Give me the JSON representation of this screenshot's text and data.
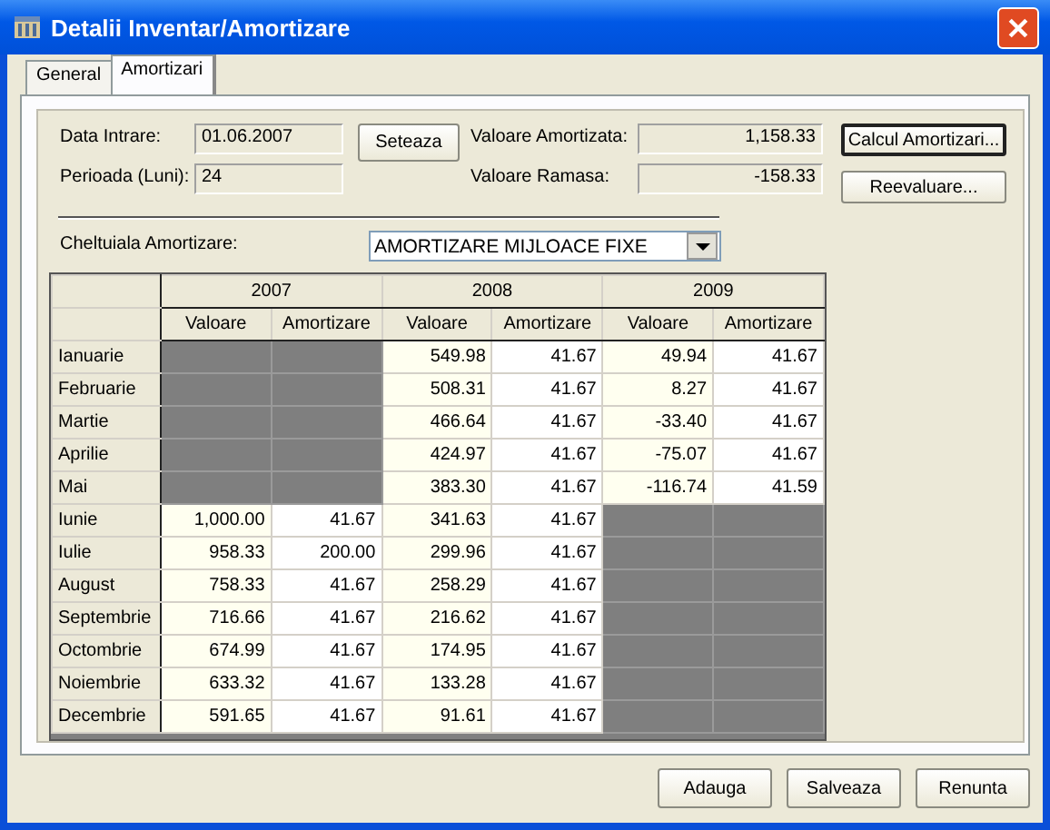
{
  "window": {
    "title": "Detalii Inventar/Amortizare"
  },
  "tabs": [
    {
      "label": "General",
      "selected": false
    },
    {
      "label": "Amortizari",
      "selected": true
    }
  ],
  "form": {
    "data_intrare": {
      "label": "Data Intrare:",
      "value": "01.06.2007"
    },
    "perioada": {
      "label": "Perioada (Luni):",
      "value": "24"
    },
    "seteaza_button": "Seteaza",
    "valoare_amortizata": {
      "label": "Valoare Amortizata:",
      "value": "1,158.33"
    },
    "valoare_ramasa": {
      "label": "Valoare Ramasa:",
      "value": "-158.33"
    },
    "cheltuiala": {
      "label": "Cheltuiala Amortizare:",
      "value": "AMORTIZARE MIJLOACE FIXE"
    }
  },
  "side_buttons": [
    {
      "label": "Calcul Amortizari...",
      "default": true
    },
    {
      "label": "Reevaluare...",
      "default": false
    }
  ],
  "table": {
    "years": [
      {
        "year": "2007",
        "columns": [
          "Valoare",
          "Amortizare"
        ]
      },
      {
        "year": "2008",
        "columns": [
          "Valoare",
          "Amortizare"
        ]
      },
      {
        "year": "2009",
        "columns": [
          "Valoare",
          "Amortizare"
        ]
      }
    ],
    "rows": [
      {
        "month": "Ianuarie",
        "cells": [
          {
            "disabled": true
          },
          {
            "disabled": true
          },
          {
            "disabled": false,
            "text": "549.98"
          },
          {
            "disabled": false,
            "text": "41.67"
          },
          {
            "disabled": false,
            "text": "49.94"
          },
          {
            "disabled": false,
            "text": "41.67"
          }
        ]
      },
      {
        "month": "Februarie",
        "cells": [
          {
            "disabled": true
          },
          {
            "disabled": true
          },
          {
            "disabled": false,
            "text": "508.31"
          },
          {
            "disabled": false,
            "text": "41.67"
          },
          {
            "disabled": false,
            "text": "8.27"
          },
          {
            "disabled": false,
            "text": "41.67"
          }
        ]
      },
      {
        "month": "Martie",
        "cells": [
          {
            "disabled": true
          },
          {
            "disabled": true
          },
          {
            "disabled": false,
            "text": "466.64"
          },
          {
            "disabled": false,
            "text": "41.67"
          },
          {
            "disabled": false,
            "text": "-33.40"
          },
          {
            "disabled": false,
            "text": "41.67"
          }
        ]
      },
      {
        "month": "Aprilie",
        "cells": [
          {
            "disabled": true
          },
          {
            "disabled": true
          },
          {
            "disabled": false,
            "text": "424.97"
          },
          {
            "disabled": false,
            "text": "41.67"
          },
          {
            "disabled": false,
            "text": "-75.07"
          },
          {
            "disabled": false,
            "text": "41.67"
          }
        ]
      },
      {
        "month": "Mai",
        "cells": [
          {
            "disabled": true
          },
          {
            "disabled": true
          },
          {
            "disabled": false,
            "text": "383.30"
          },
          {
            "disabled": false,
            "text": "41.67"
          },
          {
            "disabled": false,
            "text": "-116.74"
          },
          {
            "disabled": false,
            "text": "41.59"
          }
        ]
      },
      {
        "month": "Iunie",
        "cells": [
          {
            "disabled": false,
            "text": "1,000.00"
          },
          {
            "disabled": false,
            "text": "41.67"
          },
          {
            "disabled": false,
            "text": "341.63"
          },
          {
            "disabled": false,
            "text": "41.67"
          },
          {
            "disabled": true
          },
          {
            "disabled": true
          }
        ]
      },
      {
        "month": "Iulie",
        "cells": [
          {
            "disabled": false,
            "text": "958.33"
          },
          {
            "disabled": false,
            "text": "200.00"
          },
          {
            "disabled": false,
            "text": "299.96"
          },
          {
            "disabled": false,
            "text": "41.67"
          },
          {
            "disabled": true
          },
          {
            "disabled": true
          }
        ]
      },
      {
        "month": "August",
        "cells": [
          {
            "disabled": false,
            "text": "758.33"
          },
          {
            "disabled": false,
            "text": "41.67"
          },
          {
            "disabled": false,
            "text": "258.29"
          },
          {
            "disabled": false,
            "text": "41.67"
          },
          {
            "disabled": true
          },
          {
            "disabled": true
          }
        ]
      },
      {
        "month": "Septembrie",
        "cells": [
          {
            "disabled": false,
            "text": "716.66"
          },
          {
            "disabled": false,
            "text": "41.67"
          },
          {
            "disabled": false,
            "text": "216.62"
          },
          {
            "disabled": false,
            "text": "41.67"
          },
          {
            "disabled": true
          },
          {
            "disabled": true
          }
        ]
      },
      {
        "month": "Octombrie",
        "cells": [
          {
            "disabled": false,
            "text": "674.99"
          },
          {
            "disabled": false,
            "text": "41.67"
          },
          {
            "disabled": false,
            "text": "174.95"
          },
          {
            "disabled": false,
            "text": "41.67"
          },
          {
            "disabled": true
          },
          {
            "disabled": true
          }
        ]
      },
      {
        "month": "Noiembrie",
        "cells": [
          {
            "disabled": false,
            "text": "633.32"
          },
          {
            "disabled": false,
            "text": "41.67"
          },
          {
            "disabled": false,
            "text": "133.28"
          },
          {
            "disabled": false,
            "text": "41.67"
          },
          {
            "disabled": true
          },
          {
            "disabled": true
          }
        ]
      },
      {
        "month": "Decembrie",
        "cells": [
          {
            "disabled": false,
            "text": "591.65"
          },
          {
            "disabled": false,
            "text": "41.67"
          },
          {
            "disabled": false,
            "text": "91.61"
          },
          {
            "disabled": false,
            "text": "41.67"
          },
          {
            "disabled": true
          },
          {
            "disabled": true
          }
        ]
      }
    ]
  },
  "buttons": [
    "Adauga",
    "Salveaza",
    "Renunta"
  ]
}
